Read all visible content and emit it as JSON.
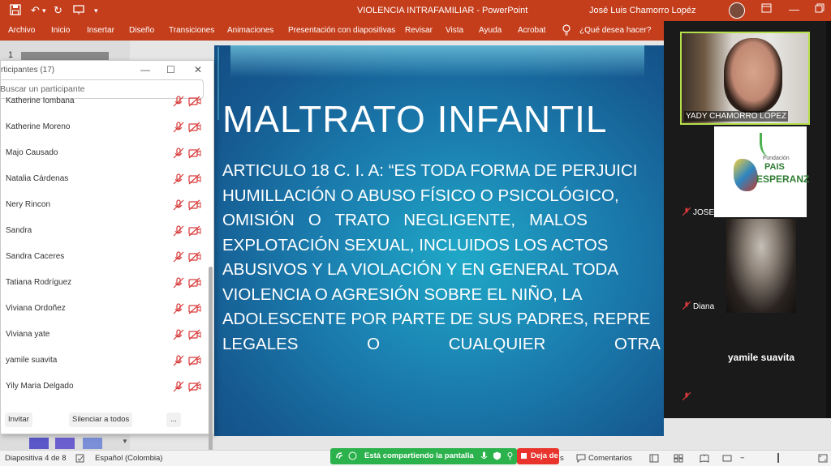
{
  "window": {
    "title": "VIOLENCIA INTRAFAMILIAR  -  PowerPoint",
    "user": "José Luis Chamorro Lopéz"
  },
  "ribbon": {
    "tabs": [
      "Archivo",
      "Inicio",
      "Insertar",
      "Diseño",
      "Transiciones",
      "Animaciones",
      "Presentación con diapositivas",
      "Revisar",
      "Vista",
      "Ayuda",
      "Acrobat"
    ],
    "tell_me": "¿Qué desea hacer?"
  },
  "thumbnails": {
    "slide_number": "1"
  },
  "slide": {
    "title": "MALTRATO INFANTIL",
    "body_lines": [
      "ARTICULO 18 C. I. A: “ES TODA FORMA DE PERJUICI",
      "HUMILLACIÓN O ABUSO FÍSICO O PSICOLÓGICO,",
      "OMISIÓN   O   TRATO   NEGLIGENTE,   MALOS",
      "EXPLOTACIÓN SEXUAL, INCLUIDOS LOS ACTOS",
      "ABUSIVOS Y LA VIOLACIÓN Y EN GENERAL TODA",
      "VIOLENCIA O AGRESIÓN SOBRE EL NIÑO, LA",
      "ADOLESCENTE POR PARTE DE SUS PADRES, REPRE"
    ],
    "last_line_words": [
      "LEGALES",
      "O",
      "CUALQUIER",
      "OTRA"
    ]
  },
  "participants": {
    "title": "rticipantes (17)",
    "search_placeholder": "Buscar un participante",
    "list": [
      "Katherine Iombana",
      "Katherine Moreno",
      "Majo Causado",
      "Natalia Cárdenas",
      "Nery Rincon",
      "Sandra",
      "Sandra Caceres",
      "Tatiana Rodríguez",
      "Viviana Ordoñez",
      "Viviana yate",
      "yamile suavita",
      "Yily Maria Delgado"
    ],
    "invite_label": "Invitar",
    "mute_all_label": "Silenciar a todos",
    "more_label": "..."
  },
  "video_tiles": {
    "speaker_name": "YADY CHAMORRO LOPEZ",
    "tile2_name": "JOSE CHAMORRO",
    "tile2_logo_lines": [
      "Fundación",
      "PAIS",
      "ESPERANZA"
    ],
    "tile3_name": "Diana",
    "tile4_name": "yamile suavita"
  },
  "statusbar": {
    "slide_info": "Diapositiva 4 de 8",
    "language": "Español (Colombia)",
    "notes_fragment": "s",
    "comments": "Comentarios"
  },
  "share": {
    "status": "Está compartiendo la pantalla",
    "stop_label": "Deja de"
  },
  "colors": {
    "powerpoint_accent": "#c43e1c",
    "share_green": "#2bb24c",
    "stop_red": "#e8342c",
    "active_speaker_border": "#b6e04a",
    "muted_red": "#d93a3a"
  }
}
